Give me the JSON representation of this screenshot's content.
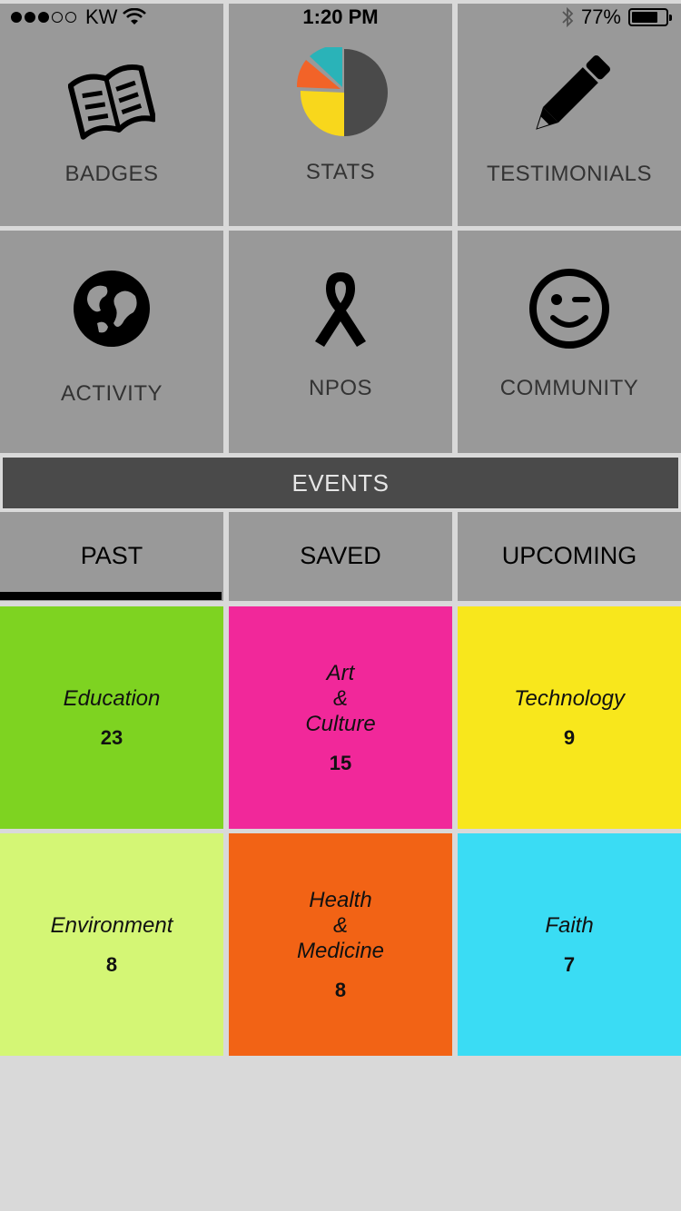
{
  "status_bar": {
    "carrier": "KW",
    "time": "1:20 PM",
    "battery": "77%",
    "battery_level": 0.77,
    "signal_icon": "signal-dots-icon",
    "wifi_icon": "wifi-icon",
    "bluetooth_icon": "bluetooth-icon"
  },
  "menu": [
    {
      "label": "BADGES",
      "icon": "book-icon"
    },
    {
      "label": "STATS",
      "icon": "pie-chart-icon"
    },
    {
      "label": "TESTIMONIALS",
      "icon": "pencil-icon"
    },
    {
      "label": "ACTIVITY",
      "icon": "globe-icon"
    },
    {
      "label": "NPOS",
      "icon": "ribbon-icon"
    },
    {
      "label": "COMMUNITY",
      "icon": "smiley-wink-icon"
    }
  ],
  "events": {
    "title": "EVENTS",
    "tabs": [
      "PAST",
      "SAVED",
      "UPCOMING"
    ],
    "active_tab": "PAST"
  },
  "categories": [
    {
      "name": "Education",
      "count": "23",
      "color": "#7ed321"
    },
    {
      "name": "Art\n&\nCulture",
      "count": "15",
      "color": "#f1289a"
    },
    {
      "name": "Technology",
      "count": "9",
      "color": "#f8e71c"
    },
    {
      "name": "Environment",
      "count": "8",
      "color": "#d4f675"
    },
    {
      "name": "Health\n&\nMedicine",
      "count": "8",
      "color": "#f26315"
    },
    {
      "name": "Faith",
      "count": "7",
      "color": "#3adcf4"
    }
  ],
  "colors": {
    "tile_gray": "#999999",
    "events_bar": "#4a4a4a",
    "background": "#d9d9d9"
  }
}
